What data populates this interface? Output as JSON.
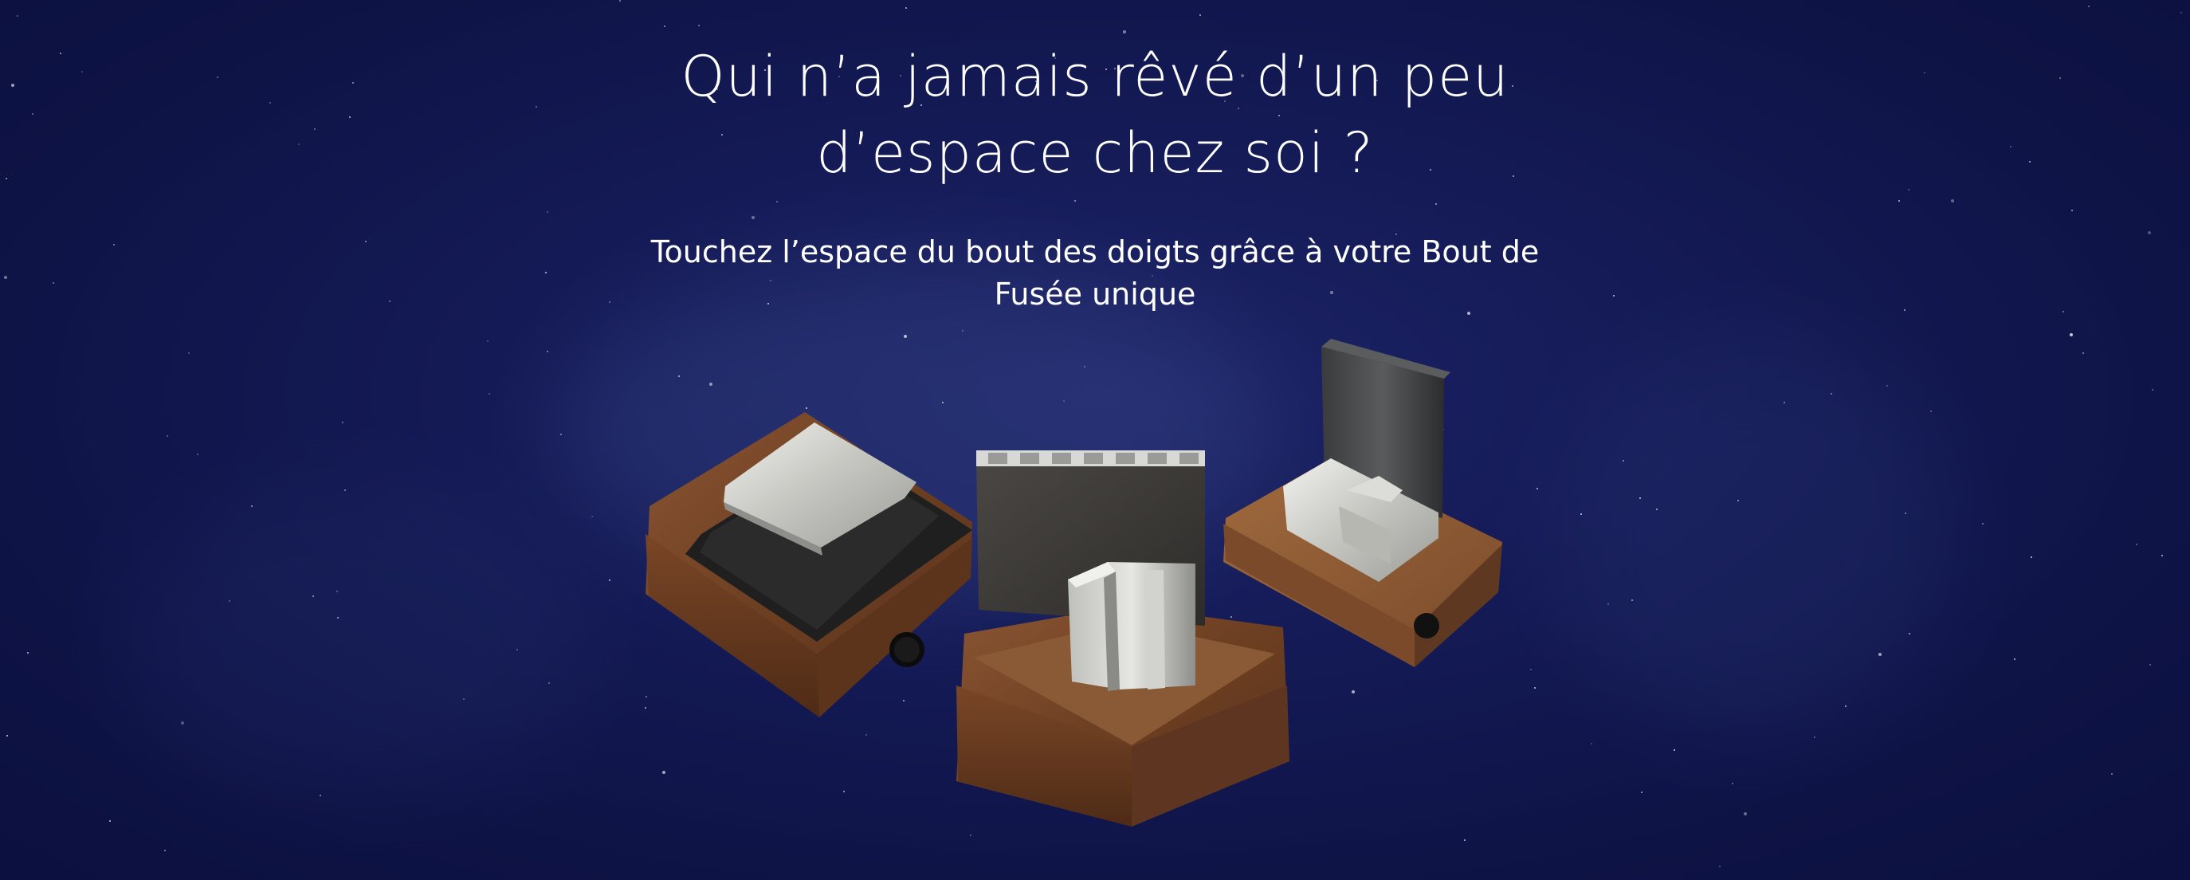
{
  "hero": {
    "title_line1": "Qui n’a jamais rêvé d’un peu",
    "title_line2": "d’espace chez soi ?",
    "subtitle_line1": "Touchez l’espace du bout des doigts grâce à votre Bout de",
    "subtitle_line2": "Fusée unique",
    "product_image_alt": "Bout de Fusée"
  },
  "colors": {
    "background": "#141a55",
    "text": "#ffffff",
    "wood": "#7a4a2a",
    "metal": "#c8c8c8",
    "panel": "#3a3836"
  }
}
